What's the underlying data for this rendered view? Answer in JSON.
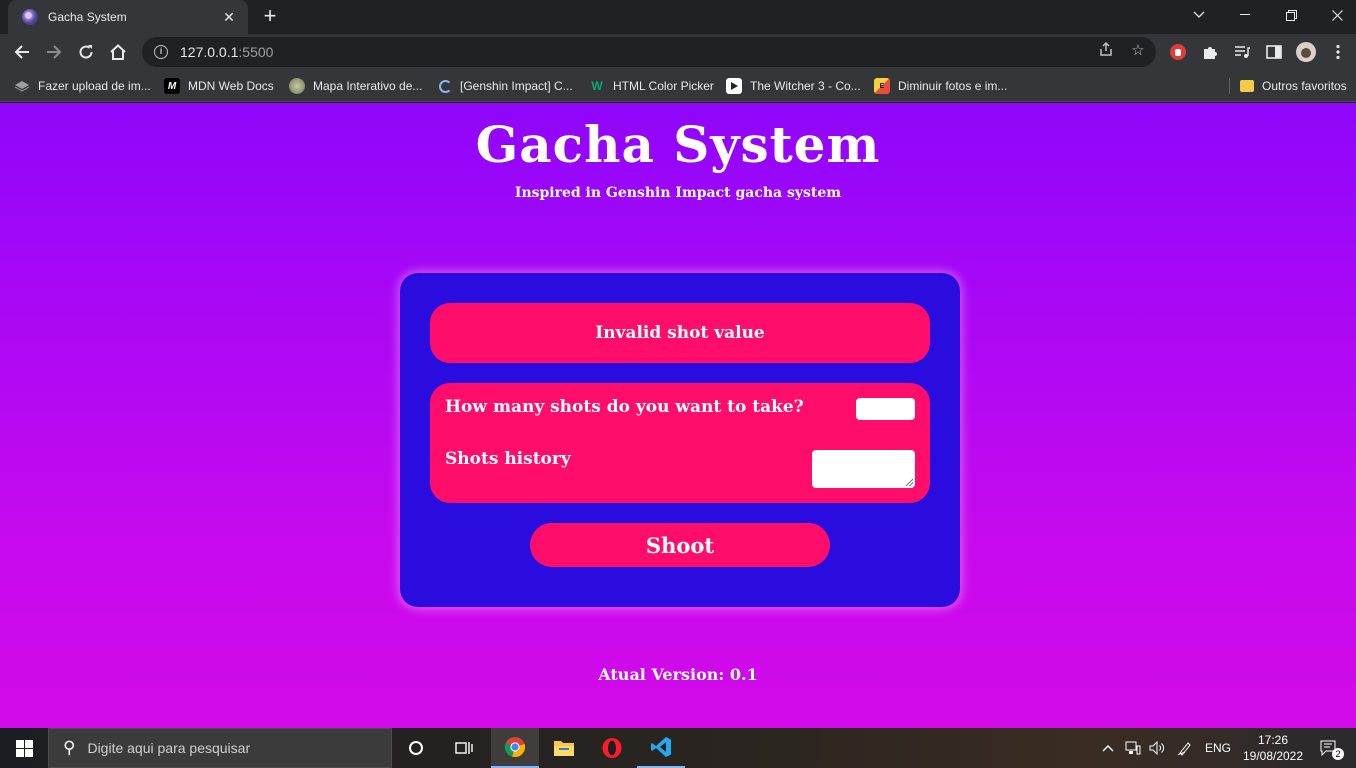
{
  "browser": {
    "tab_title": "Gacha System",
    "tab_close": "✕",
    "new_tab": "+",
    "url_host": "127.0.0.1",
    "url_port": ":5500",
    "bookmarks": [
      {
        "label": "Fazer upload de im...",
        "icon": "upload-cloud-icon"
      },
      {
        "label": "MDN Web Docs",
        "icon": "mdn-logo-icon"
      },
      {
        "label": "Mapa Interativo de...",
        "icon": "map-globe-icon"
      },
      {
        "label": "[Genshin Impact] C...",
        "icon": "loading-ring-icon"
      },
      {
        "label": "HTML Color Picker",
        "icon": "w3schools-logo-icon"
      },
      {
        "label": "The Witcher 3 - Co...",
        "icon": "play-box-icon"
      },
      {
        "label": "Diminuir fotos e im...",
        "icon": "easy-logo-icon"
      }
    ],
    "other_bookmarks": "Outros favoritos"
  },
  "page": {
    "title": "Gacha System",
    "subtitle": "Inspired in Genshin Impact gacha system",
    "message": "Invalid shot value",
    "shots_label": "How many shots do you want to take?",
    "shots_value": "",
    "history_label": "Shots history",
    "history_value": "",
    "shoot_label": "Shoot",
    "version": "Atual Version: 0.1"
  },
  "taskbar": {
    "search_placeholder": "Digite aqui para pesquisar",
    "language": "ENG",
    "time": "17:26",
    "date": "19/08/2022",
    "notifications": "2"
  },
  "colors": {
    "accent_pink": "#ff0d6b",
    "card_blue": "#2a0cde",
    "background_purple": "#8f06fb",
    "background_magenta": "#d20ae9"
  }
}
